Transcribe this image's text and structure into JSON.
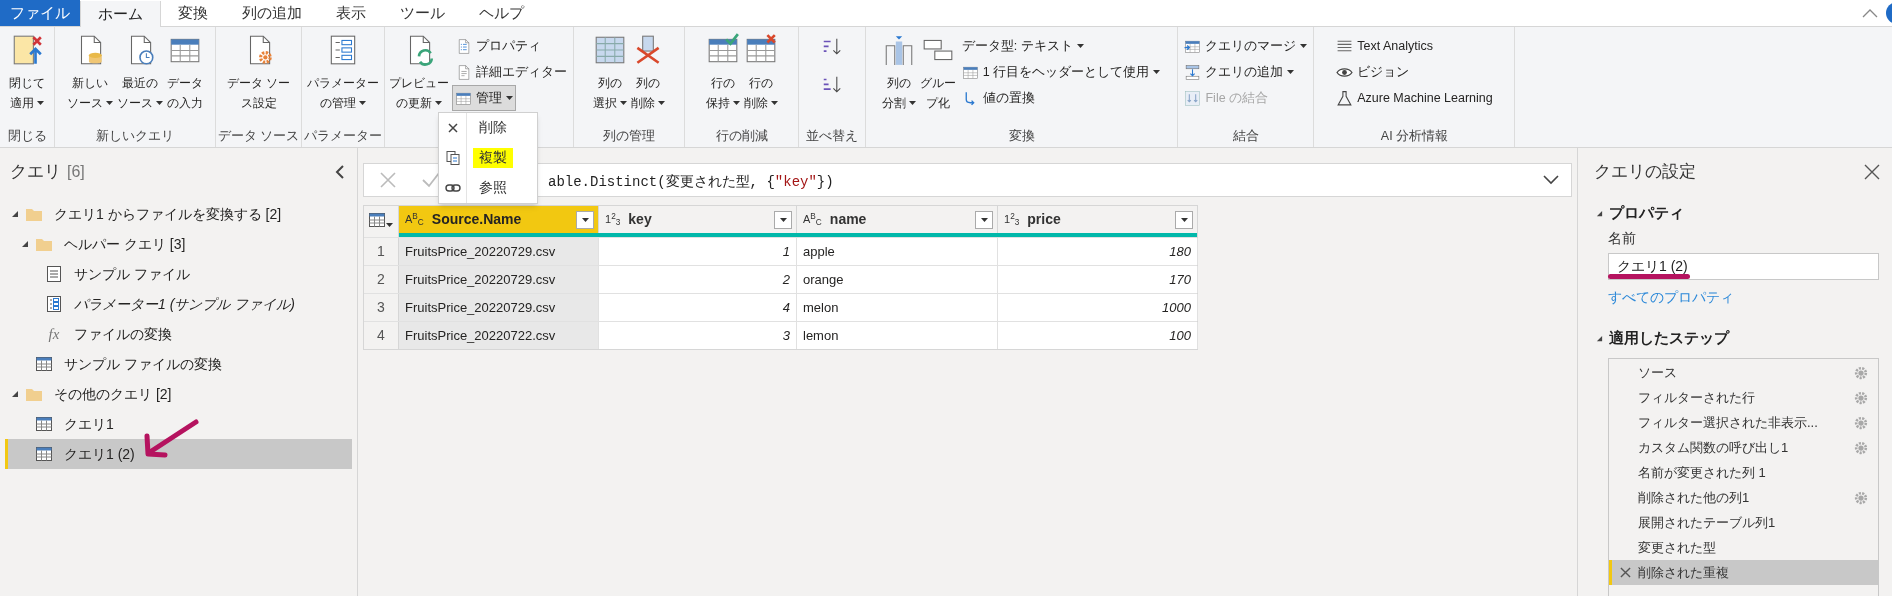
{
  "tabs": [
    {
      "label": "ファイル",
      "kind": "file",
      "selected": false
    },
    {
      "label": "ホーム",
      "kind": "tab",
      "selected": true
    },
    {
      "label": "変換",
      "kind": "tab",
      "selected": false
    },
    {
      "label": "列の追加",
      "kind": "tab",
      "selected": false
    },
    {
      "label": "表示",
      "kind": "tab",
      "selected": false
    },
    {
      "label": "ツール",
      "kind": "tab",
      "selected": false
    },
    {
      "label": "ヘルプ",
      "kind": "tab",
      "selected": false
    }
  ],
  "ribbon": {
    "groups": [
      {
        "label": "閉じる",
        "items": [
          {
            "kind": "large",
            "lines": [
              "閉じて",
              "適用"
            ],
            "dropdown": true
          }
        ]
      },
      {
        "label": "新しいクエリ",
        "items": [
          {
            "kind": "large",
            "lines": [
              "新しい",
              "ソース"
            ],
            "dropdown": true
          },
          {
            "kind": "large",
            "lines": [
              "最近の",
              "ソース"
            ],
            "dropdown": true
          },
          {
            "kind": "large",
            "lines": [
              "データ",
              "の入力"
            ],
            "dropdown": false
          }
        ]
      },
      {
        "label": "データ ソース",
        "items": [
          {
            "kind": "large",
            "lines": [
              "データ ソー",
              "ス設定"
            ],
            "dropdown": false
          }
        ]
      },
      {
        "label": "パラメーター",
        "items": [
          {
            "kind": "large",
            "lines": [
              "パラメーター",
              "の管理"
            ],
            "dropdown": true
          }
        ]
      },
      {
        "items": [
          {
            "kind": "large",
            "lines": [
              "プレビュー",
              "の更新"
            ],
            "dropdown": true
          },
          {
            "kind": "small",
            "label": "プロパティ",
            "dropdown": false
          },
          {
            "kind": "small",
            "label": "詳細エディター",
            "dropdown": false
          },
          {
            "kind": "small",
            "label": "管理",
            "dropdown": true,
            "expanded": true
          }
        ]
      },
      {
        "label": "列の管理",
        "items": [
          {
            "kind": "large",
            "lines": [
              "列の",
              "選択"
            ],
            "dropdown": true
          },
          {
            "kind": "large",
            "lines": [
              "列の",
              "削除"
            ],
            "dropdown": true
          }
        ]
      },
      {
        "label": "行の削減",
        "items": [
          {
            "kind": "large",
            "lines": [
              "行の",
              "保持"
            ],
            "dropdown": true
          },
          {
            "kind": "large",
            "lines": [
              "行の",
              "削除"
            ],
            "dropdown": true
          }
        ]
      },
      {
        "label": "並べ替え",
        "items": [
          {
            "kind": "icon"
          },
          {
            "kind": "icon"
          }
        ]
      },
      {
        "label": "変換",
        "items": [
          {
            "kind": "large",
            "lines": [
              "列の",
              "分割"
            ],
            "dropdown": true
          },
          {
            "kind": "large",
            "lines": [
              "グルー",
              "プ化"
            ],
            "dropdown": false
          },
          {
            "kind": "small",
            "label": "データ型: テキスト",
            "dropdown": true
          },
          {
            "kind": "small",
            "label": "1 行目をヘッダーとして使用",
            "dropdown": true
          },
          {
            "kind": "small",
            "label": "値の置換",
            "dropdown": false
          }
        ]
      },
      {
        "label": "結合",
        "items": [
          {
            "kind": "small",
            "label": "クエリのマージ",
            "dropdown": true
          },
          {
            "kind": "small",
            "label": "クエリの追加",
            "dropdown": true
          },
          {
            "kind": "small",
            "label": "File の結合",
            "dropdown": false,
            "disabled": true
          }
        ]
      },
      {
        "label": "AI 分析情報",
        "items": [
          {
            "kind": "small",
            "label": "Text Analytics",
            "dropdown": false
          },
          {
            "kind": "small",
            "label": "ビジョン",
            "dropdown": false
          },
          {
            "kind": "small",
            "label": "Azure Machine Learning",
            "dropdown": false
          }
        ]
      }
    ]
  },
  "menu": {
    "items": [
      {
        "label": "削除"
      },
      {
        "label": "複製"
      },
      {
        "label": "参照"
      }
    ]
  },
  "queries": {
    "title": "クエリ",
    "count": "[6]",
    "tree": [
      {
        "kind": "folder",
        "label": "クエリ1 からファイルを変換する [2]",
        "expanded": true,
        "selected": false,
        "children": [
          {
            "kind": "folder",
            "label": "ヘルパー クエリ [3]",
            "expanded": true,
            "selected": false,
            "children": [
              {
                "kind": "doc",
                "label": "サンプル ファイル",
                "selected": false
              },
              {
                "kind": "param",
                "label": "パラメーター1 (サンプル ファイル)",
                "selected": false
              },
              {
                "kind": "fx",
                "glyph": "fx",
                "label": "ファイルの変換",
                "selected": false
              }
            ]
          },
          {
            "kind": "table",
            "label": "サンプル ファイルの変換",
            "selected": false
          }
        ]
      },
      {
        "kind": "folder",
        "label": "その他のクエリ [2]",
        "expanded": true,
        "selected": false,
        "children": [
          {
            "kind": "table",
            "label": "クエリ1",
            "selected": false
          },
          {
            "kind": "table",
            "label": "クエリ1 (2)",
            "selected": true
          }
        ]
      }
    ]
  },
  "formula": {
    "segments": [
      {
        "kind": "code",
        "text": "able.Distinct(変更された型, {"
      },
      {
        "kind": "string",
        "text": "\"key\""
      },
      {
        "kind": "code",
        "text": "})"
      }
    ]
  },
  "table": {
    "columns": [
      {
        "title": "Source.Name",
        "type_mark": "A$^{B}$$_{C}$",
        "kind": "text",
        "selected": true
      },
      {
        "title": "key",
        "type_mark": "1$^{2}$$_{3}$",
        "kind": "number",
        "selected": false
      },
      {
        "title": "name",
        "type_mark": "A$^{B}$$_{C}$",
        "kind": "text",
        "selected": false
      },
      {
        "title": "price",
        "type_mark": "1$^{2}$$_{3}$",
        "kind": "number",
        "selected": false
      }
    ],
    "rows": [
      {
        "number": "1",
        "cells": [
          "FruitsPrice_20220729.csv",
          "1",
          "apple",
          "180"
        ]
      },
      {
        "number": "2",
        "cells": [
          "FruitsPrice_20220729.csv",
          "2",
          "orange",
          "170"
        ]
      },
      {
        "number": "3",
        "cells": [
          "FruitsPrice_20220729.csv",
          "4",
          "melon",
          "1000"
        ]
      },
      {
        "number": "4",
        "cells": [
          "FruitsPrice_20220722.csv",
          "3",
          "lemon",
          "100"
        ]
      }
    ]
  },
  "settings": {
    "title": "クエリの設定",
    "properties_heading": "プロパティ",
    "name_label": "名前",
    "name_value": "クエリ1 (2)",
    "all_properties_link": "すべてのプロパティ",
    "steps_heading": "適用したステップ",
    "steps": [
      {
        "label": "ソース",
        "has_settings": true,
        "selected": false
      },
      {
        "label": "フィルターされた行",
        "has_settings": true,
        "selected": false
      },
      {
        "label": "フィルター選択された非表示...",
        "has_settings": true,
        "selected": false
      },
      {
        "label": "カスタム関数の呼び出し1",
        "has_settings": true,
        "selected": false
      },
      {
        "label": "名前が変更された列 1",
        "has_settings": false,
        "selected": false
      },
      {
        "label": "削除された他の列1",
        "has_settings": true,
        "selected": false
      },
      {
        "label": "展開されたテーブル列1",
        "has_settings": false,
        "selected": false
      },
      {
        "label": "変更された型",
        "has_settings": false,
        "selected": false
      },
      {
        "label": "削除された重複",
        "has_settings": false,
        "selected": true
      }
    ]
  },
  "annotations": [
    {
      "kind": "highlight"
    },
    {
      "kind": "arrow"
    },
    {
      "kind": "underline"
    }
  ]
}
